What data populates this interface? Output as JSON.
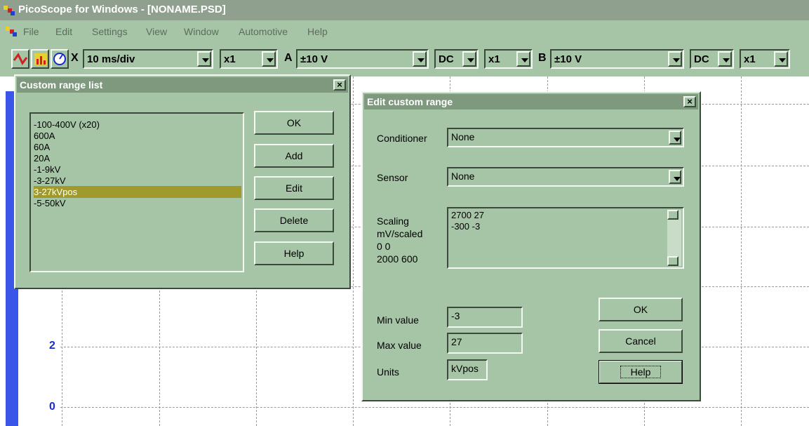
{
  "window": {
    "title": "PicoScope for Windows - [NONAME.PSD]"
  },
  "menu": [
    "File",
    "Edit",
    "Settings",
    "View",
    "Window",
    "Automotive",
    "Help"
  ],
  "toolbar": {
    "x_label": "X",
    "timebase": "10 ms/div",
    "x_mult": "x1",
    "a_label": "A",
    "a_range": "±10 V",
    "a_coupling": "DC",
    "a_mult": "x1",
    "b_label": "B",
    "b_range": "±10 V",
    "b_coupling": "DC",
    "b_mult": "x1"
  },
  "graph": {
    "y_ticks": [
      "2",
      "0"
    ]
  },
  "custom_range_list": {
    "title": "Custom range list",
    "close": "×",
    "items": [
      "-100-400V (x20)",
      "600A",
      "60A",
      "20A",
      "-1-9kV",
      "-3-27kV",
      "3-27kVpos",
      "-5-50kV"
    ],
    "selected_index": 6,
    "buttons": {
      "ok": "OK",
      "add": "Add",
      "edit": "Edit",
      "delete": "Delete",
      "help": "Help"
    }
  },
  "edit_custom_range": {
    "title": "Edit custom range",
    "close": "×",
    "conditioner_label": "Conditioner",
    "conditioner_value": "None",
    "sensor_label": "Sensor",
    "sensor_value": "None",
    "scaling_label_1": "Scaling",
    "scaling_label_2": "mV/scaled",
    "scaling_label_3": "0 0",
    "scaling_label_4": "2000 600",
    "scaling_text_1": "2700 27",
    "scaling_text_2": "-300 -3",
    "min_label": "Min value",
    "min_value": "-3",
    "max_label": "Max value",
    "max_value": "27",
    "units_label": "Units",
    "units_value": "kVpos",
    "buttons": {
      "ok": "OK",
      "cancel": "Cancel",
      "help": "Help"
    }
  },
  "colors": {
    "dialog_bg": "#a6c4a6",
    "caption_bg": "#7f997f",
    "selection": "#a09a2c",
    "axis_blue": "#1a2bd0"
  }
}
